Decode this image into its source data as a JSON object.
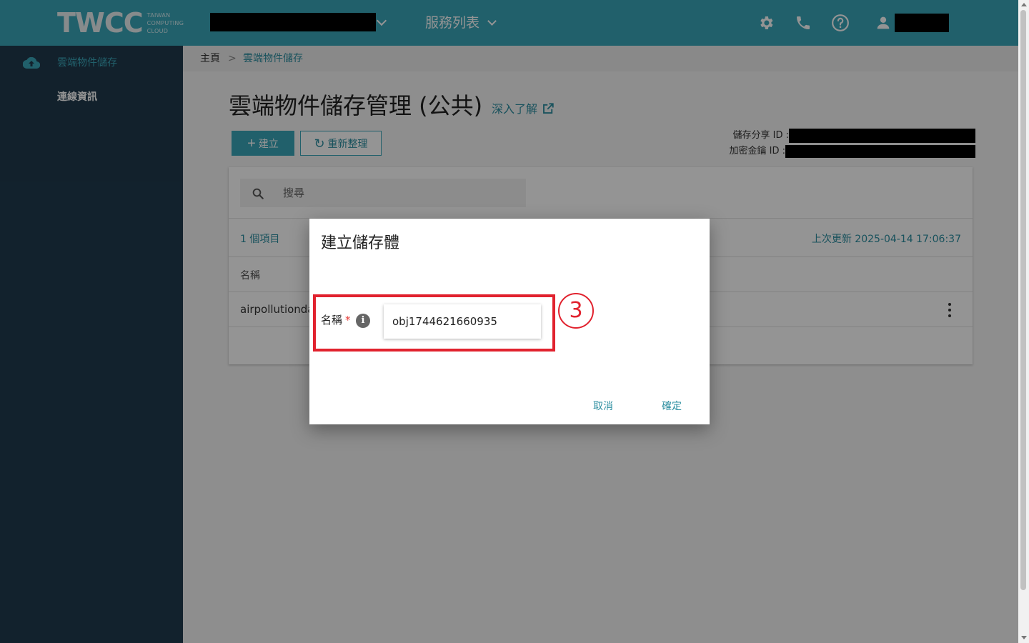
{
  "header": {
    "logo_text": "TWCC",
    "logo_sub_1": "TAIWAN",
    "logo_sub_2": "COMPUTING",
    "logo_sub_3": "CLOUD",
    "services_label": "服務列表"
  },
  "sidebar": {
    "items": [
      {
        "label": "雲端物件儲存"
      },
      {
        "label": "連線資訊"
      }
    ]
  },
  "breadcrumb": {
    "home": "主頁",
    "separator": ">",
    "current": "雲端物件儲存"
  },
  "main": {
    "title": "雲端物件儲存管理 (公共)",
    "learn_more": "深入了解",
    "create_label": "建立",
    "refresh_label": "重新整理",
    "share_id_label": "儲存分享 ID :",
    "key_id_label": "加密金鑰 ID :",
    "search_placeholder": "搜尋",
    "item_count": "1 個項目",
    "last_update": "上次更新 2025-04-14 17:06:37",
    "column_name": "名稱",
    "rows": [
      {
        "name": "airpollutiondat"
      }
    ]
  },
  "dialog": {
    "title": "建立儲存體",
    "field_label": "名稱",
    "required_mark": "*",
    "info_glyph": "i",
    "name_value": "obj1744621660935",
    "step_marker": "3",
    "cancel_label": "取消",
    "confirm_label": "確定"
  },
  "colors": {
    "accent": "#3aa6b9",
    "sidebar_bg": "#1f3a4d",
    "highlight": "#e1222e"
  }
}
